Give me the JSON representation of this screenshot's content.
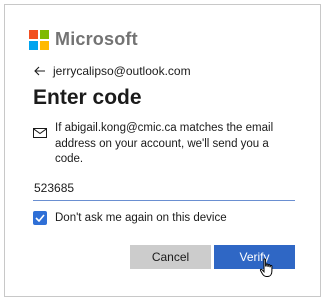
{
  "brand": {
    "name": "Microsoft",
    "colors": [
      "#f25022",
      "#7fba00",
      "#00a4ef",
      "#ffb900"
    ]
  },
  "header": {
    "account": "jerrycalipso@outlook.com",
    "back_icon": "back-arrow-icon"
  },
  "page": {
    "title": "Enter code"
  },
  "info": {
    "icon": "email-icon",
    "text": "If abigail.kong@cmic.ca matches the email address on your account, we'll send you a code."
  },
  "code_input": {
    "value": "523685"
  },
  "remember": {
    "checked": true,
    "label": "Don't ask me again on this device"
  },
  "actions": {
    "cancel_label": "Cancel",
    "verify_label": "Verify"
  },
  "colors": {
    "primary": "#2f67c5",
    "secondary_button": "#cccccc",
    "checkbox": "#2f6fd6"
  }
}
